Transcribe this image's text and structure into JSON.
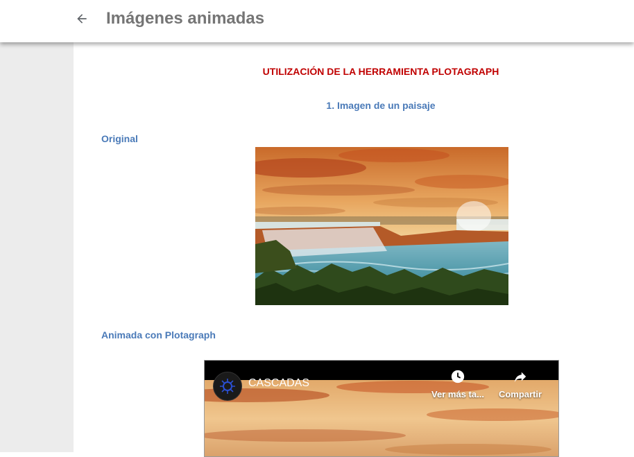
{
  "header": {
    "title": "Imágenes animadas",
    "back_icon": "arrow-back-icon"
  },
  "main": {
    "heading": "UTILIZACIÓN DE LA HERRAMIENTA PLOTAGRAPH",
    "subheading": "1. Imagen de un paisaje",
    "original_label": "Original",
    "animated_label": "Animada con Plotagraph"
  },
  "video": {
    "title": "CASCADAS",
    "watch_later_label": "Ver más ta...",
    "share_label": "Compartir",
    "watch_later_icon": "clock-icon",
    "share_icon": "share-arrow-icon"
  },
  "colors": {
    "heading_red": "#c00000",
    "label_blue": "#4a7ab8",
    "title_gray": "#757575",
    "gutter_gray": "#ececec"
  }
}
